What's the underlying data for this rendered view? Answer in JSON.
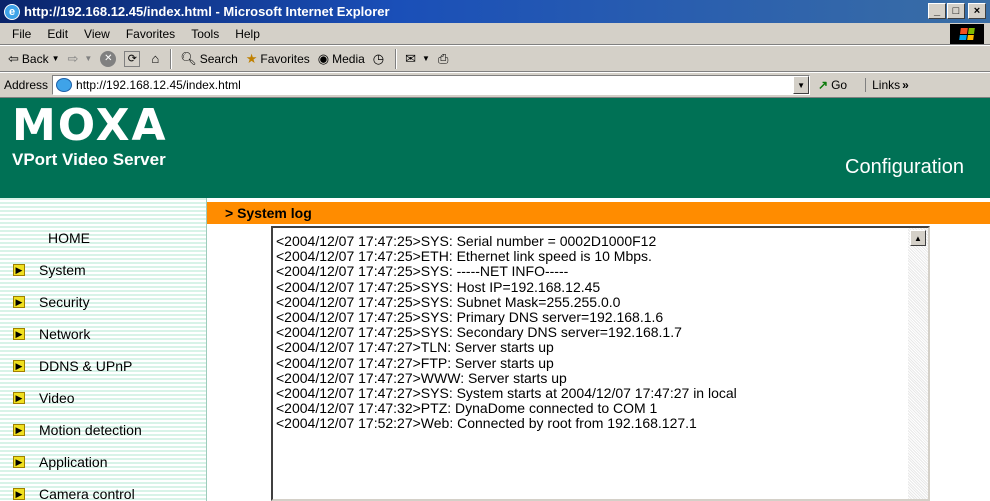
{
  "window": {
    "title": "http://192.168.12.45/index.html - Microsoft Internet Explorer",
    "minimize": "_",
    "maximize": "□",
    "close": "×"
  },
  "menu": [
    "File",
    "Edit",
    "View",
    "Favorites",
    "Tools",
    "Help"
  ],
  "toolbar": {
    "back": "Back",
    "search": "Search",
    "favorites": "Favorites",
    "media": "Media"
  },
  "address": {
    "label": "Address",
    "url": "http://192.168.12.45/index.html",
    "go": "Go",
    "links": "Links"
  },
  "header": {
    "logo": "MOXA",
    "product": "VPort Video Server",
    "section": "Configuration"
  },
  "nav": [
    "HOME",
    "System",
    "Security",
    "Network",
    "DDNS & UPnP",
    "Video",
    "Motion detection",
    "Application",
    "Camera control"
  ],
  "page": {
    "title": "> System log",
    "log": [
      "<2004/12/07 17:47:25>SYS: Serial number = 0002D1000F12",
      "<2004/12/07 17:47:25>ETH: Ethernet link speed is 10 Mbps.",
      "<2004/12/07 17:47:25>SYS: -----NET INFO-----",
      "<2004/12/07 17:47:25>SYS: Host IP=192.168.12.45",
      "<2004/12/07 17:47:25>SYS: Subnet Mask=255.255.0.0",
      "<2004/12/07 17:47:25>SYS: Primary DNS server=192.168.1.6",
      "<2004/12/07 17:47:25>SYS: Secondary DNS server=192.168.1.7",
      "<2004/12/07 17:47:27>TLN: Server starts up",
      "<2004/12/07 17:47:27>FTP: Server starts up",
      "<2004/12/07 17:47:27>WWW: Server starts up",
      "<2004/12/07 17:47:27>SYS: System starts at 2004/12/07 17:47:27 in local",
      "<2004/12/07 17:47:32>PTZ: DynaDome connected to COM 1",
      "<2004/12/07 17:52:27>Web: Connected by root from 192.168.127.1"
    ]
  },
  "colors": {
    "header_bg": "#007155",
    "title_bar": "#ff8c00",
    "nav_stripe": "#d8f3e8"
  }
}
